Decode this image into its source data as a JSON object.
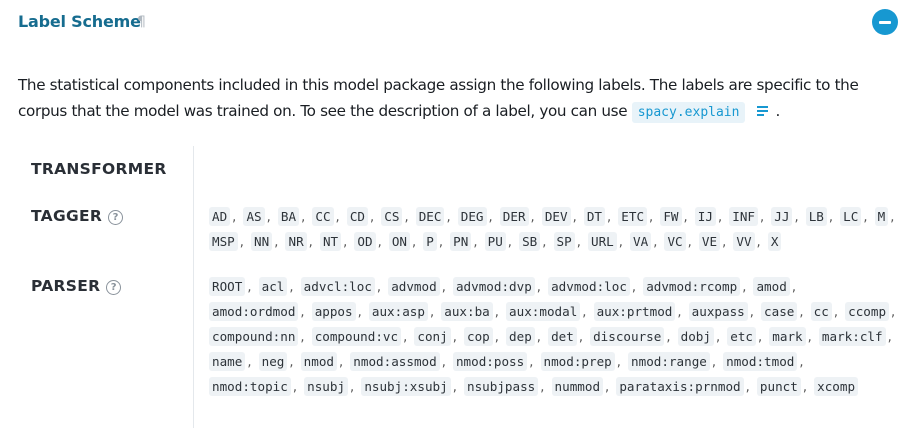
{
  "section": {
    "title": "Label Scheme",
    "pilcrow": "¶"
  },
  "intro": {
    "text": "The statistical components included in this model package assign the following labels. The labels are specific to the corpus that the model was trained on. To see the description of a label, you can use",
    "code": "spacy.explain",
    "end": "."
  },
  "rows": {
    "transformer": {
      "label": "TRANSFORMER"
    },
    "tagger": {
      "label": "TAGGER",
      "help": "?",
      "labels": [
        "AD",
        "AS",
        "BA",
        "CC",
        "CD",
        "CS",
        "DEC",
        "DEG",
        "DER",
        "DEV",
        "DT",
        "ETC",
        "FW",
        "IJ",
        "INF",
        "JJ",
        "LB",
        "LC",
        "M",
        "MSP",
        "NN",
        "NR",
        "NT",
        "OD",
        "ON",
        "P",
        "PN",
        "PU",
        "SB",
        "SP",
        "URL",
        "VA",
        "VC",
        "VE",
        "VV",
        "X"
      ]
    },
    "parser": {
      "label": "PARSER",
      "help": "?",
      "labels": [
        "ROOT",
        "acl",
        "advcl:loc",
        "advmod",
        "advmod:dvp",
        "advmod:loc",
        "advmod:rcomp",
        "amod",
        "amod:ordmod",
        "appos",
        "aux:asp",
        "aux:ba",
        "aux:modal",
        "aux:prtmod",
        "auxpass",
        "case",
        "cc",
        "ccomp",
        "compound:nn",
        "compound:vc",
        "conj",
        "cop",
        "dep",
        "det",
        "discourse",
        "dobj",
        "etc",
        "mark",
        "mark:clf",
        "name",
        "neg",
        "nmod",
        "nmod:assmod",
        "nmod:poss",
        "nmod:prep",
        "nmod:range",
        "nmod:tmod",
        "nmod:topic",
        "nsubj",
        "nsubj:xsubj",
        "nsubjpass",
        "nummod",
        "parataxis:prnmod",
        "punct",
        "xcomp"
      ]
    }
  },
  "colors": {
    "accent": "#1798d1",
    "title": "#166c8f",
    "tag_bg": "#eef2f5",
    "code_bg": "#e8f3f9"
  },
  "icons": {
    "collapse": "minus-circle-icon",
    "docs": "docs-list-icon",
    "help": "help-circle-icon"
  }
}
